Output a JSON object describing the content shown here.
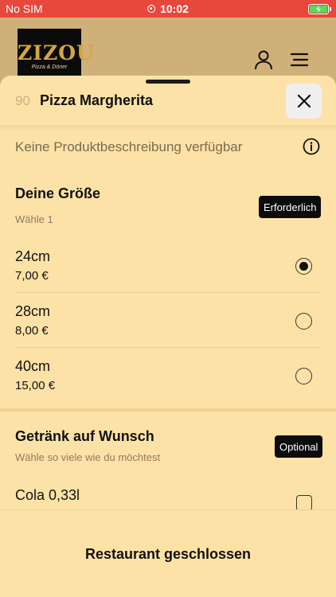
{
  "status_bar": {
    "carrier": "No SIM",
    "time": "10:02",
    "battery_color": "#5cd65c",
    "background_color": "#e8473c"
  },
  "header": {
    "logo_title": "ZIZOU",
    "logo_subtitle": "Pizza & Döner",
    "icons": [
      "user-icon",
      "menu-icon"
    ]
  },
  "sheet": {
    "product_number": "90",
    "product_name": "Pizza Margherita",
    "description": "Keine Produktbeschreibung verfügbar",
    "sections": [
      {
        "title": "Deine Größe",
        "subtitle": "Wähle 1",
        "badge": "Erforderlich",
        "options": [
          {
            "label": "24cm",
            "price": "7,00 €",
            "selected": true
          },
          {
            "label": "28cm",
            "price": "8,00 €",
            "selected": false
          },
          {
            "label": "40cm",
            "price": "15,00 €",
            "selected": false
          }
        ]
      },
      {
        "title": "Getränk auf Wunsch",
        "subtitle": "Wähle so viele wie du möchtest",
        "badge": "Optional",
        "options": [
          {
            "label": "Cola 0,33l",
            "selected": false
          }
        ]
      }
    ]
  },
  "footer": {
    "message": "Restaurant geschlossen"
  },
  "colors": {
    "sheet_background": "#fde2a8",
    "header_background": "#cfb078",
    "badge_background": "#0c0c0c"
  }
}
